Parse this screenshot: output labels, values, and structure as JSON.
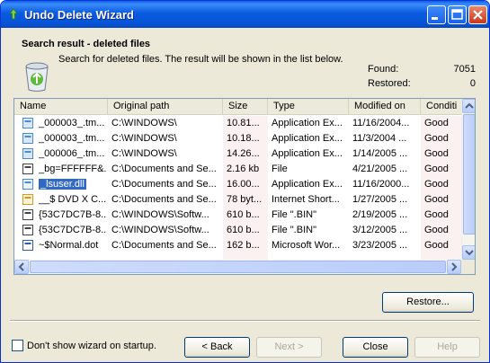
{
  "window": {
    "title": "Undo Delete Wizard"
  },
  "header": {
    "heading": "Search result - deleted files",
    "description": "Search for deleted files. The result will be shown in the list below.",
    "found_label": "Found:",
    "found_value": "7051",
    "restored_label": "Restored:",
    "restored_value": "0"
  },
  "list": {
    "columns": [
      "Name",
      "Original path",
      "Size",
      "Type",
      "Modified on",
      "Conditi"
    ],
    "rows": [
      {
        "icon": "exe-icon",
        "name": "_000003_.tm...",
        "path": "C:\\WINDOWS\\",
        "size": "10.81...",
        "type": "Application Ex...",
        "modified": "11/16/2004...",
        "condition": "Good"
      },
      {
        "icon": "exe-icon",
        "name": "_000003_.tm...",
        "path": "C:\\WINDOWS\\",
        "size": "10.18...",
        "type": "Application Ex...",
        "modified": "11/3/2004 ...",
        "condition": "Good"
      },
      {
        "icon": "exe-icon",
        "name": "_000006_.tm...",
        "path": "C:\\WINDOWS\\",
        "size": "14.26...",
        "type": "Application Ex...",
        "modified": "1/14/2005 ...",
        "condition": "Good"
      },
      {
        "icon": "file-icon",
        "name": "_bg=FFFFFF&...",
        "path": "C:\\Documents and Se...",
        "size": "2.16 kb",
        "type": "File",
        "modified": "4/21/2005 ...",
        "condition": "Good"
      },
      {
        "icon": "dll-icon",
        "name": "_lsuser.dll",
        "path": "C:\\Documents and Se...",
        "size": "16.00...",
        "type": "Application Ex...",
        "modified": "11/16/2000...",
        "condition": "Good",
        "selected": true
      },
      {
        "icon": "shortcut-icon",
        "name": "__$ DVD X C...",
        "path": "C:\\Documents and Se...",
        "size": "78 byt...",
        "type": "Internet Short...",
        "modified": "1/27/2005 ...",
        "condition": "Good"
      },
      {
        "icon": "file-icon",
        "name": "{53C7DC7B-8...",
        "path": "C:\\WINDOWS\\Softw...",
        "size": "610 b...",
        "type": "File \".BIN\"",
        "modified": "2/19/2005 ...",
        "condition": "Good"
      },
      {
        "icon": "file-icon",
        "name": "{53C7DC7B-8...",
        "path": "C:\\WINDOWS\\Softw...",
        "size": "610 b...",
        "type": "File \".BIN\"",
        "modified": "3/12/2005 ...",
        "condition": "Good"
      },
      {
        "icon": "word-icon",
        "name": "~$Normal.dot",
        "path": "C:\\Documents and Se...",
        "size": "162 b...",
        "type": "Microsoft Wor...",
        "modified": "3/23/2005 ...",
        "condition": "Good"
      }
    ]
  },
  "buttons": {
    "restore": "Restore...",
    "back": "< Back",
    "next": "Next >",
    "close": "Close",
    "help": "Help"
  },
  "footer": {
    "dont_show_label": "Don't show wizard on startup.",
    "dont_show_checked": false
  },
  "colors": {
    "titlebar": "#0a5be0",
    "selection": "#316ac5",
    "face": "#ece9d8"
  }
}
